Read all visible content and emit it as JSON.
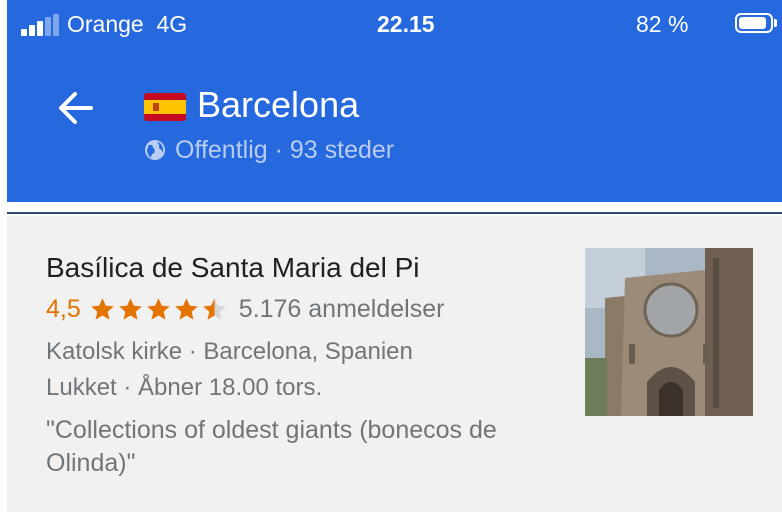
{
  "status_bar": {
    "carrier": "Orange",
    "network": "4G",
    "time": "22.15",
    "battery": "82 %",
    "battery_level": 0.82
  },
  "header": {
    "title": "Barcelona",
    "subtitle": "Offentlig · 93 steder"
  },
  "place": {
    "name": "Basílica de Santa Maria del Pi",
    "rating": "4,5",
    "rating_value": 4.5,
    "reviews": "5.176 anmeldelser",
    "category_location": "Katolsk kirke · Barcelona, Spanien",
    "hours": "Lukket · Åbner 18.00 tors.",
    "review_quote": "\"Collections of oldest giants (bonecos de Olinda)\""
  },
  "icons": {
    "back": "arrow-left-icon",
    "flag": "spain-flag-icon",
    "visibility": "globe-icon",
    "star": "star-icon"
  },
  "colors": {
    "app_bar": "#2668dd",
    "rating": "#e37400",
    "star_empty": "#d5d5d5",
    "card_bg": "#f1f1f1"
  }
}
